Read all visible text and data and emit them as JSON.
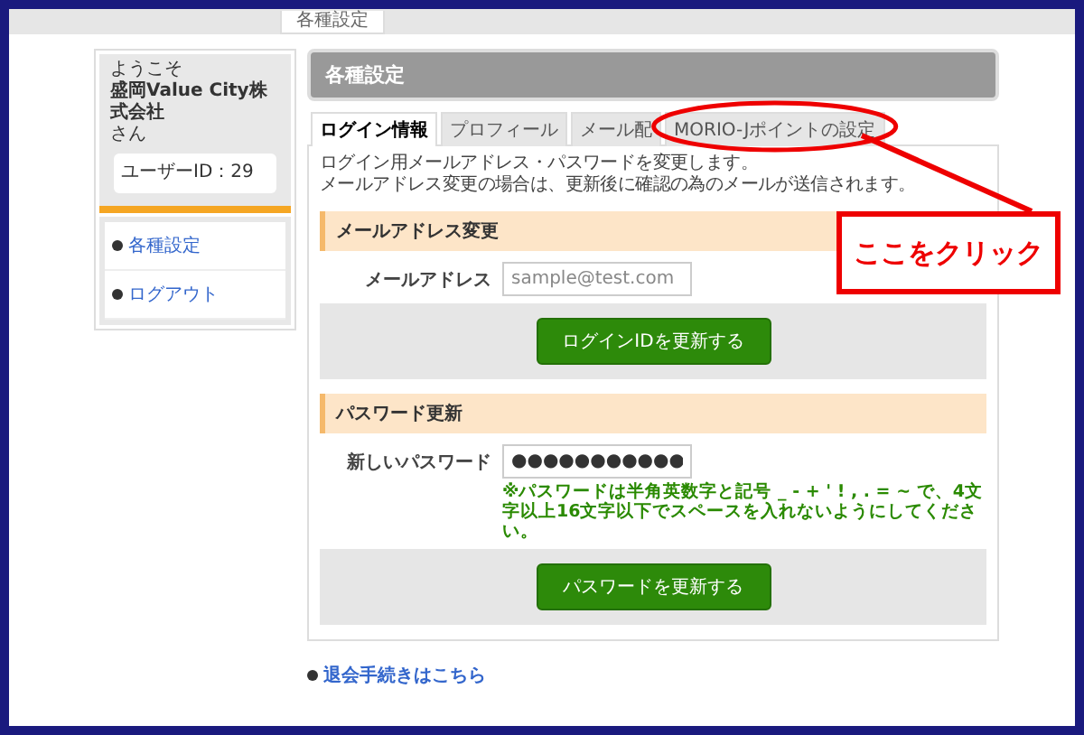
{
  "breadcrumb": {
    "current": "各種設定"
  },
  "sidebar": {
    "welcome": "ようこそ",
    "company": "盛岡Value City株式会社",
    "suffix": "さん",
    "user_id": "ユーザーID：29",
    "menu": [
      {
        "label": "各種設定"
      },
      {
        "label": "ログアウト"
      }
    ]
  },
  "header": {
    "title": "各種設定"
  },
  "tabs": [
    {
      "label": "ログイン情報",
      "selected": true,
      "circled": false
    },
    {
      "label": "プロフィール",
      "selected": false,
      "circled": false
    },
    {
      "label": "メール配",
      "selected": false,
      "circled": false
    },
    {
      "label": "MORIO-Jポイントの設定",
      "selected": false,
      "circled": true
    }
  ],
  "intro": [
    "ログイン用メールアドレス・パスワードを変更します。",
    "メールアドレス変更の場合は、更新後に確認の為のメールが送信されます。"
  ],
  "sections": [
    {
      "heading": "メールアドレス変更",
      "field_label": "メールアドレス",
      "placeholder": "sample@test.com",
      "button": "ログインIDを更新する"
    },
    {
      "heading": "パスワード更新",
      "field_label": "新しいパスワード",
      "value": "●●●●●●●●●●●",
      "hint": "※パスワードは半角英数字と記号 _ - + ' ! , . = ~ で、4文字以上16文字以下でスペースを入れないようにしてください。",
      "button": "パスワードを更新する"
    }
  ],
  "withdraw_link": "退会手続きはこちら",
  "callout": {
    "text": "ここをクリック"
  }
}
